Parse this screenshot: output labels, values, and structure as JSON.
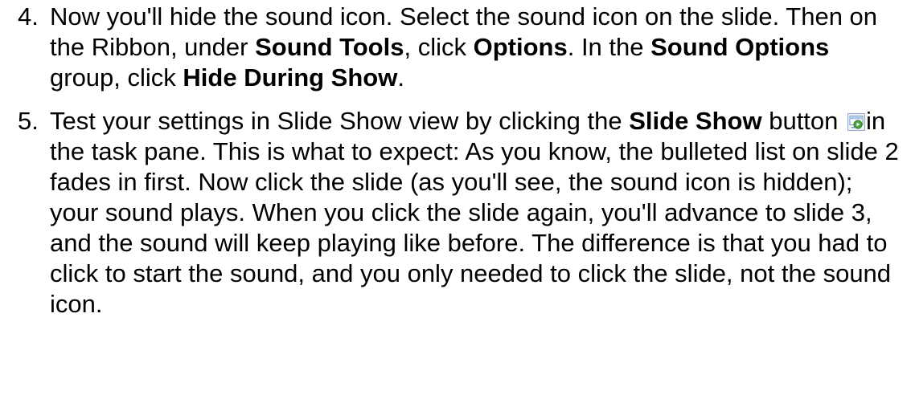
{
  "steps": [
    {
      "number": "4.",
      "parts": {
        "a": "Now you'll hide the sound icon. Select the sound icon on the slide. Then on the Ribbon, under ",
        "b": "Sound Tools",
        "c": ", click ",
        "d": "Options",
        "e": ". In the ",
        "f": "Sound Options",
        "g": " group, click ",
        "h": "Hide During Show",
        "i": "."
      }
    },
    {
      "number": "5.",
      "parts": {
        "a": "Test your settings in Slide Show view by clicking the ",
        "b": "Slide Show",
        "c": " button ",
        "d": "in the task pane. This is what to expect: As you know, the bulleted list on slide 2 fades in first. Now click the slide (as you'll see, the sound icon is hidden); your sound plays. When you click the slide again, you'll advance to slide 3, and the sound will keep playing like before. The difference is that you had to click to start the sound, and you only needed to click the slide, not the sound icon."
      },
      "icon": "slide-show-icon"
    }
  ]
}
